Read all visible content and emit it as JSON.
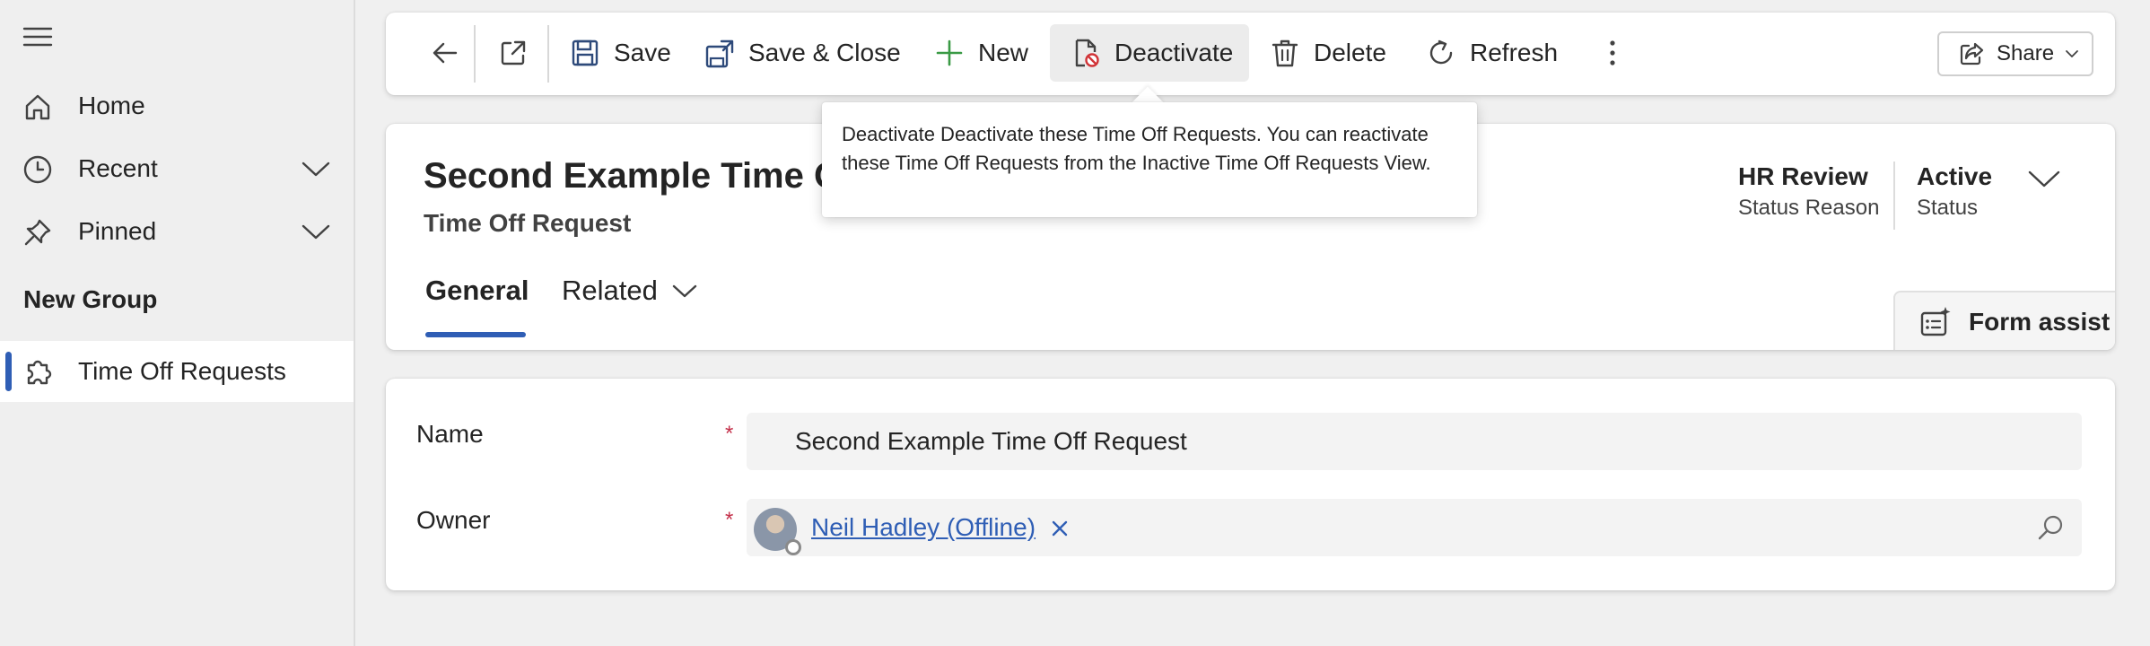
{
  "sidebar": {
    "items": [
      {
        "label": "Home",
        "icon": "home-icon"
      },
      {
        "label": "Recent",
        "icon": "clock-icon"
      },
      {
        "label": "Pinned",
        "icon": "pin-icon"
      }
    ],
    "group_label": "New Group",
    "selected_item": {
      "label": "Time Off Requests",
      "icon": "puzzle-icon"
    }
  },
  "commandbar": {
    "save": "Save",
    "save_close": "Save & Close",
    "new": "New",
    "deactivate": "Deactivate",
    "delete": "Delete",
    "refresh": "Refresh",
    "share": "Share"
  },
  "tooltip": {
    "text": "Deactivate Deactivate these Time Off Requests. You can reactivate these Time Off Requests from the Inactive Time Off Requests View."
  },
  "record": {
    "title": "Second Example Time Of",
    "entity": "Time Off Request",
    "header_fields": [
      {
        "value": "HR Review",
        "label": "Status Reason"
      },
      {
        "value": "Active",
        "label": "Status"
      }
    ]
  },
  "tabs": {
    "general": "General",
    "related": "Related"
  },
  "form_assist": "Form assist",
  "form": {
    "name_label": "Name",
    "name_value": "Second Example Time Off Request",
    "owner_label": "Owner",
    "owner_value": "Neil Hadley (Offline)",
    "required_mark": "*"
  },
  "colors": {
    "accent": "#2f5eb5",
    "required": "#c4314b",
    "new_icon": "#3a9a45",
    "deactivate_badge": "#d13438"
  }
}
